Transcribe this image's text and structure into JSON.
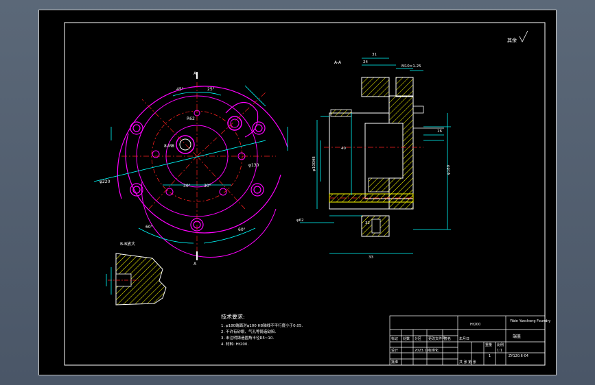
{
  "title_block": {
    "material": "Ht200",
    "part_name": "端盖",
    "drawing_no": "ZY120.6-04",
    "school": "Yibin Yancheng Foundry",
    "row_labels": [
      "标记",
      "处数",
      "分区",
      "更改文件号",
      "签名",
      "年月日"
    ],
    "designer": "设计",
    "standard": "标准化",
    "approve": "批准",
    "scale": "1:1",
    "date": "2023.12",
    "sheet_info": "共 张  第 张",
    "count": "1",
    "weight_label": "重量",
    "ratio_label": "比例"
  },
  "roughness_note": "其余",
  "section_labels": {
    "aa": "A-A",
    "bb": "B-B放大",
    "a_top": "A",
    "a_bottom": "A"
  },
  "tech_requirements": {
    "title": "技术要求:",
    "items": [
      "1. φ180端面对φ100 H8轴线不平行度小于0.05.",
      "2. 不许有砂眼、气孔等铸造缺陷.",
      "3. 未注明铸造圆角半径R5~10.",
      "4. 材料: Ht200."
    ]
  },
  "dimensions": {
    "angle_45": "45°",
    "angle_25": "25°",
    "angle_30a": "30°",
    "angle_30b": "30°",
    "angle_60a": "60°",
    "angle_60b": "60°",
    "r_62": "R62",
    "phi_130": "φ130",
    "phi_220": "φ220",
    "m8": "8-M8",
    "d31": "31",
    "d24": "24",
    "d16": "16",
    "d40": "40",
    "d32": "32",
    "d33": "33",
    "phi_180": "φ180",
    "phi_100": "φ100H8",
    "m10": "M10×1.25",
    "phi_62": "φ62"
  },
  "colors": {
    "magenta": "#ff00ff",
    "red": "#ff2020",
    "cyan": "#00ffff",
    "yellow": "#ffff00",
    "white": "#ffffff",
    "green": "#00ff66"
  }
}
